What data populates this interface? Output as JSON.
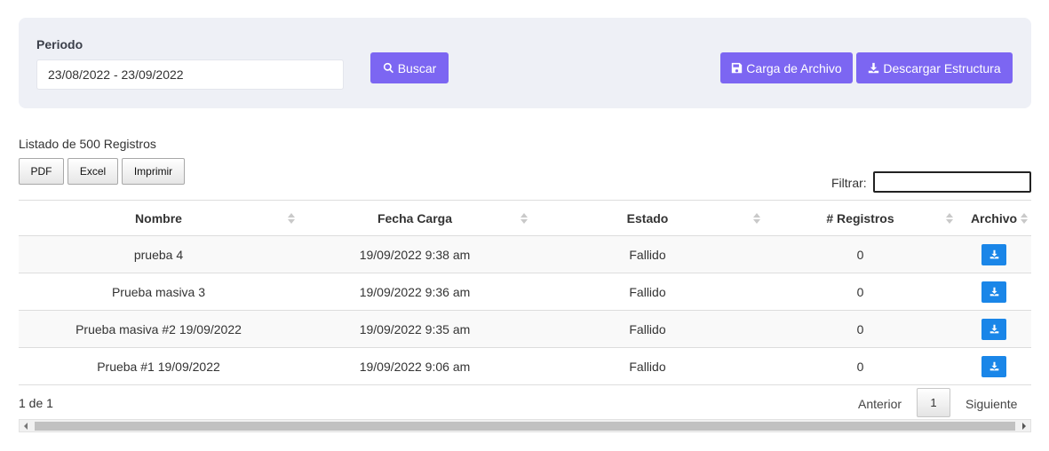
{
  "filters": {
    "period_label": "Periodo",
    "period_value": "23/08/2022 - 23/09/2022",
    "search_label": "Buscar",
    "upload_label": "Carga de Archivo",
    "download_structure_label": "Descargar Estructura"
  },
  "listing": {
    "records_count_text": "Listado de 500 Registros",
    "export_buttons": {
      "pdf": "PDF",
      "excel": "Excel",
      "print": "Imprimir"
    },
    "filter_label": "Filtrar:",
    "filter_value": ""
  },
  "table": {
    "columns": [
      "Nombre",
      "Fecha Carga",
      "Estado",
      "# Registros",
      "Archivo"
    ],
    "rows": [
      {
        "nombre": "prueba 4",
        "fecha": "19/09/2022 9:38 am",
        "estado": "Fallido",
        "registros": "0"
      },
      {
        "nombre": "Prueba masiva 3",
        "fecha": "19/09/2022 9:36 am",
        "estado": "Fallido",
        "registros": "0"
      },
      {
        "nombre": "Prueba masiva #2 19/09/2022",
        "fecha": "19/09/2022 9:35 am",
        "estado": "Fallido",
        "registros": "0"
      },
      {
        "nombre": "Prueba #1 19/09/2022",
        "fecha": "19/09/2022 9:06 am",
        "estado": "Fallido",
        "registros": "0"
      }
    ]
  },
  "pagination": {
    "page_info": "1 de 1",
    "prev_label": "Anterior",
    "current_page": "1",
    "next_label": "Siguiente"
  },
  "colors": {
    "primary_button": "#7c66f2",
    "download_file_button": "#1a86e8",
    "panel_background": "#eef0f6"
  },
  "icons": {
    "search": "search-icon",
    "upload": "save-icon",
    "download": "download-icon"
  }
}
